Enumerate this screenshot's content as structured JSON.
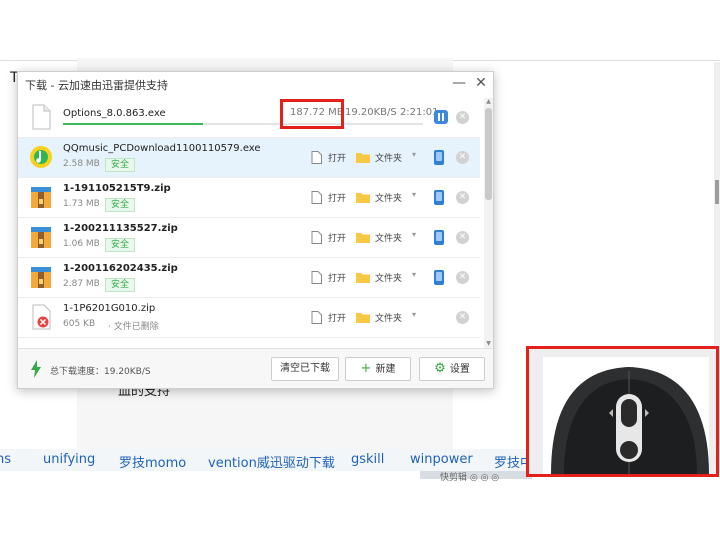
{
  "background": {
    "left_glyph": "T",
    "fragment": "血的支持",
    "tags": [
      "ons",
      "unifying",
      "罗技momo",
      "vention威迅驱动下载",
      "gskill",
      "winpower",
      "罗技中国"
    ],
    "taskbar_text": "快剪辑  ◎  ◎  ◎"
  },
  "window": {
    "title": "下载 - 云加速由迅雷提供支持",
    "minimize_symbol": "—",
    "close_symbol": "✕"
  },
  "active_download": {
    "filename": "Options_8.0.863.exe",
    "size": "187.72 MB",
    "speed_eta": "19.20KB/S 2:21:01",
    "progress": 0.39
  },
  "downloads": [
    {
      "name": "QQmusic_PCDownload1100110579.exe",
      "size": "2.58 MB",
      "badge": "安全",
      "icon": "qqmusic-icon",
      "selected": true
    },
    {
      "name": "1-191105215T9.zip",
      "size": "1.73 MB",
      "badge": "安全",
      "icon": "zip-icon"
    },
    {
      "name": "1-200211135527.zip",
      "size": "1.06 MB",
      "badge": "安全",
      "icon": "zip-icon"
    },
    {
      "name": "1-200116202435.zip",
      "size": "2.87 MB",
      "badge": "安全",
      "icon": "zip-icon"
    },
    {
      "name": "1-1P6201G010.zip",
      "size": "605 KB",
      "status": "· 文件已删除",
      "icon": "deleted-file-icon"
    }
  ],
  "actions": {
    "open": "打开",
    "folder": "文件夹",
    "dropdown": "▾",
    "remove": "✕"
  },
  "footer": {
    "total_speed": "总下载速度：19.20KB/S",
    "clear_button": "清空已下载",
    "new_button": "新建",
    "new_icon": "+",
    "settings_button": "设置",
    "settings_icon": "⚙"
  },
  "colors": {
    "highlight_red": "#e3201a",
    "accent_blue": "#3b88e0",
    "safe_green": "#35a946"
  }
}
